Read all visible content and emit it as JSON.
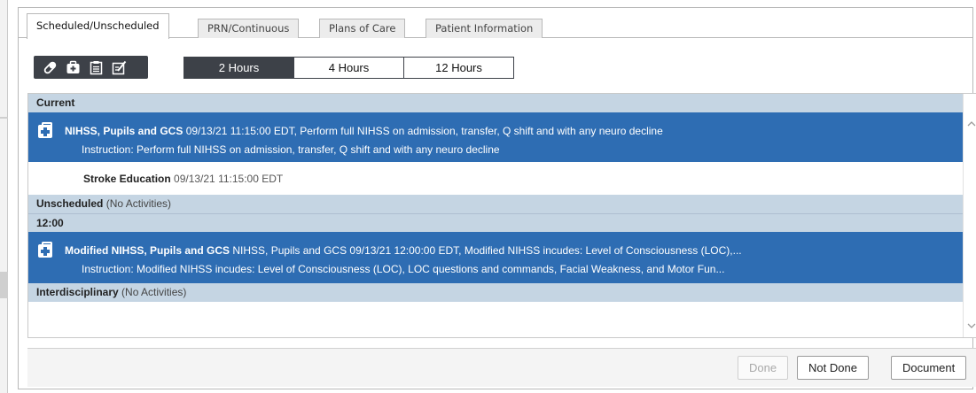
{
  "tabs": [
    {
      "label": "Scheduled/Unscheduled"
    },
    {
      "label": "PRN/Continuous"
    },
    {
      "label": "Plans of Care"
    },
    {
      "label": "Patient Information"
    }
  ],
  "time_filter": [
    "2 Hours",
    "4 Hours",
    "12 Hours"
  ],
  "sections": {
    "current": "Current",
    "unscheduled": {
      "title": "Unscheduled",
      "note": "(No Activities)"
    },
    "time_1200": "12:00",
    "interdisciplinary": {
      "title": "Interdisciplinary",
      "note": "(No Activities)"
    }
  },
  "tasks": [
    {
      "name": "NIHSS, Pupils and GCS",
      "detail": " 09/13/21 11:15:00 EDT, Perform full NIHSS on admission, transfer, Q shift and with any neuro decline",
      "instruction": "Instruction: Perform full NIHSS on admission, transfer, Q shift and with any neuro decline"
    },
    {
      "name": "Stroke Education",
      "detail": " 09/13/21 11:15:00 EDT"
    },
    {
      "name": "Modified NIHSS, Pupils and GCS",
      "detail": " NIHSS, Pupils and GCS 09/13/21 12:00:00 EDT, Modified NIHSS incudes: Level of Consciousness (LOC),...",
      "instruction": "Instruction: Modified NIHSS incudes: Level of Consciousness (LOC), LOC questions and commands, Facial Weakness, and Motor Fun..."
    }
  ],
  "footer": {
    "done": "Done",
    "not_done": "Not Done",
    "document": "Document"
  },
  "colors": {
    "selected_row": "#2e6db3",
    "section_header": "#c5d5e3",
    "toolbar_dark": "#3d4148"
  },
  "icons": [
    "pill-icon",
    "medical-bag-icon",
    "clipboard-icon",
    "checklist-edit-icon",
    "scroll-up-icon",
    "scroll-down-icon",
    "task-bag-icon"
  ]
}
